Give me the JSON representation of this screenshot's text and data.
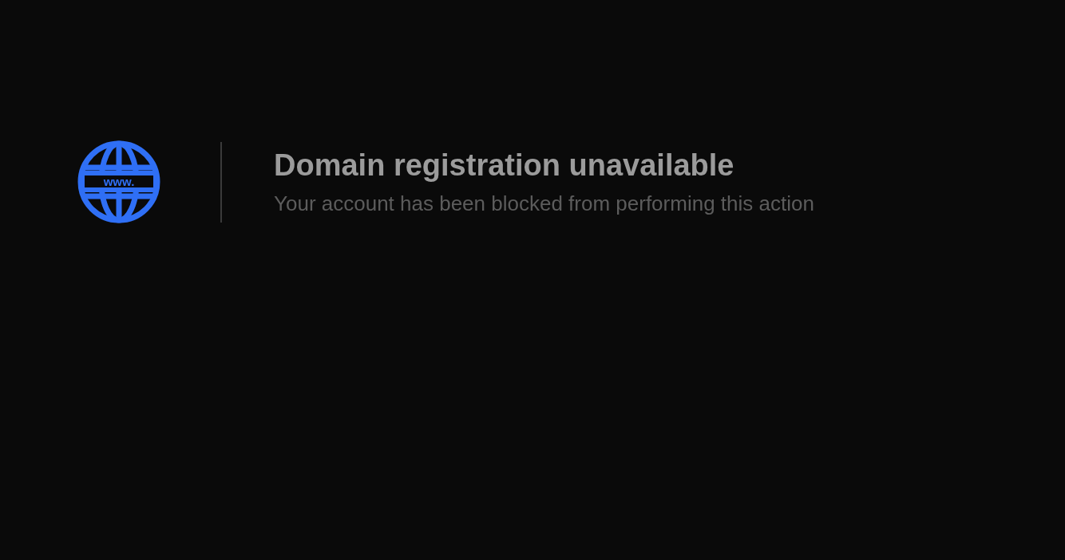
{
  "icon_label": "www.",
  "title": "Domain registration unavailable",
  "message": "Your account has been blocked from performing this action"
}
